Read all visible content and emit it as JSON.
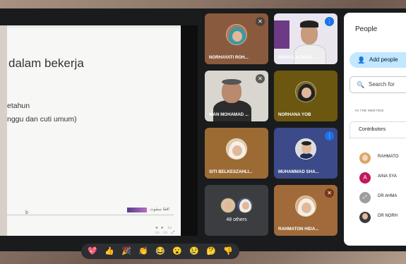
{
  "presentation": {
    "heading": "dalam bekerja",
    "line1": "etahun",
    "line2": "nggu dan cuti umum)",
    "marker": "b",
    "logo_text": "اڤڤا سڤوث",
    "controls": "◂ ▸ ▭ ▭ ▭ ⤢"
  },
  "tiles": [
    {
      "name": "NORHAYATI ROH...",
      "mic": "muted"
    },
    {
      "name": "HAIRUL AZWAD ...",
      "mic": "talk"
    },
    {
      "name": "WAN MOHAMAD ...",
      "mic": "muted"
    },
    {
      "name": "NORHANA YOB",
      "mic": "none"
    },
    {
      "name": "SITI BELKESZAHLI...",
      "mic": "none"
    },
    {
      "name": "MUHAMMAD SHA...",
      "mic": "talk"
    },
    {
      "name": "48 others",
      "mic": "none"
    },
    {
      "name": "RAHMATON HIDA...",
      "mic": "warn"
    }
  ],
  "people_panel": {
    "title": "People",
    "add_people": "Add people",
    "search_placeholder": "Search for",
    "section": "IN THE MEETING",
    "contributors": "Contributors",
    "rows": [
      {
        "name": "RAHMATO",
        "avatar": "photo",
        "color": "#d9a66a"
      },
      {
        "name": "AINA SYA",
        "avatar": "A",
        "color": "#c2185b"
      },
      {
        "name": "DR AHMA",
        "avatar": "icon",
        "color": "#9e9e9e"
      },
      {
        "name": "DR NORH",
        "avatar": "photo",
        "color": "#3b3b3b"
      }
    ]
  },
  "reactions": [
    "💖",
    "👍",
    "🎉",
    "👏",
    "😂",
    "😮",
    "😢",
    "🤔",
    "👎"
  ]
}
